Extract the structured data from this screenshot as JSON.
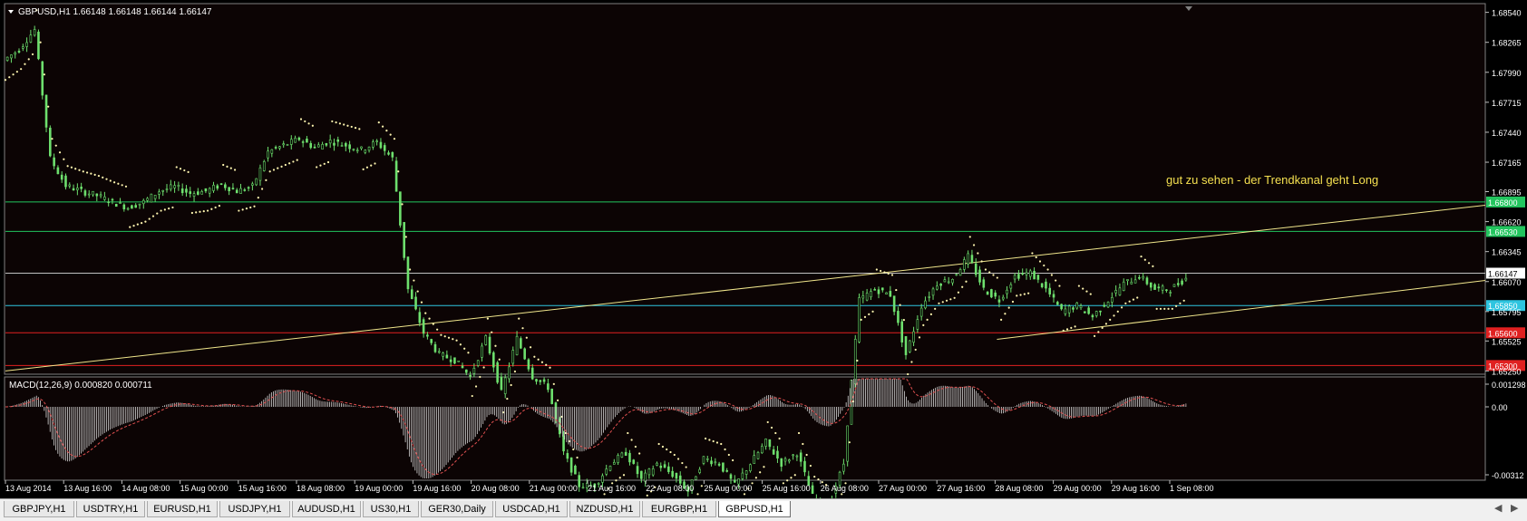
{
  "symbol_header": "GBPUSD,H1  1.66148 1.66148 1.66144 1.66147",
  "annotation": "gut zu sehen - der Trendkanal geht Long",
  "macd_header": "MACD(12,26,9) 0.000820 0.000711",
  "tabs": [
    {
      "label": "GBPJPY,H1",
      "active": false
    },
    {
      "label": "USDTRY,H1",
      "active": false
    },
    {
      "label": "EURUSD,H1",
      "active": false
    },
    {
      "label": "USDJPY,H1",
      "active": false
    },
    {
      "label": "AUDUSD,H1",
      "active": false
    },
    {
      "label": "US30,H1",
      "active": false
    },
    {
      "label": "GER30,Daily",
      "active": false
    },
    {
      "label": "USDCAD,H1",
      "active": false
    },
    {
      "label": "NZDUSD,H1",
      "active": false
    },
    {
      "label": "EURGBP,H1",
      "active": false
    },
    {
      "label": "GBPUSD,H1",
      "active": true
    }
  ],
  "chart_data": {
    "type": "candlestick",
    "symbol": "GBPUSD",
    "timeframe": "H1",
    "price_axis_ticks": [
      "1.68540",
      "1.68265",
      "1.67990",
      "1.67715",
      "1.67440",
      "1.67165",
      "1.66895",
      "1.66620",
      "1.66345",
      "1.66070",
      "1.65795",
      "1.65525",
      "1.65250"
    ],
    "ylim": [
      1.6522,
      1.6862
    ],
    "current_price": "1.66147",
    "time_axis_labels": [
      "13 Aug 2014",
      "13 Aug 16:00",
      "14 Aug 08:00",
      "15 Aug 00:00",
      "15 Aug 16:00",
      "18 Aug 08:00",
      "19 Aug 00:00",
      "19 Aug 16:00",
      "20 Aug 08:00",
      "21 Aug 00:00",
      "21 Aug 16:00",
      "22 Aug 08:00",
      "25 Aug 00:00",
      "25 Aug 16:00",
      "26 Aug 08:00",
      "27 Aug 00:00",
      "27 Aug 16:00",
      "28 Aug 08:00",
      "29 Aug 00:00",
      "29 Aug 16:00",
      "1 Sep 08:00"
    ],
    "horizontal_levels": [
      {
        "price": 1.668,
        "label": "1.66800",
        "color": "#22c55e"
      },
      {
        "price": 1.6653,
        "label": "1.66530",
        "color": "#22c55e"
      },
      {
        "price": 1.66147,
        "label": "1.66147",
        "color": "#c0c0c0"
      },
      {
        "price": 1.6585,
        "label": "1.65850",
        "color": "#2ec5e0"
      },
      {
        "price": 1.656,
        "label": "1.65600",
        "color": "#e02020"
      },
      {
        "price": 1.653,
        "label": "1.65300",
        "color": "#e02020"
      }
    ],
    "trend_lines": [
      {
        "from": [
          0,
          1.6525
        ],
        "to": [
          1.0,
          1.6677
        ],
        "color": "#f0e68c"
      },
      {
        "from": [
          0.67,
          1.6554
        ],
        "to": [
          1.0,
          1.6608
        ],
        "color": "#f0e68c"
      }
    ],
    "close_path": [
      1.681,
      1.682,
      1.6838,
      1.672,
      1.6695,
      1.669,
      1.6686,
      1.668,
      1.6675,
      1.668,
      1.669,
      1.6694,
      1.6688,
      1.669,
      1.6696,
      1.669,
      1.6694,
      1.6726,
      1.6732,
      1.6738,
      1.673,
      1.6736,
      1.6732,
      1.6728,
      1.6735,
      1.672,
      1.66,
      1.656,
      1.654,
      1.6535,
      1.652,
      1.6555,
      1.6505,
      1.6555,
      1.652,
      1.651,
      1.645,
      1.642,
      1.642,
      1.644,
      1.645,
      1.6425,
      1.644,
      1.643,
      1.6415,
      1.6445,
      1.644,
      1.642,
      1.644,
      1.646,
      1.644,
      1.645,
      1.641,
      1.64,
      1.644,
      1.659,
      1.66,
      1.6595,
      1.654,
      1.6585,
      1.6605,
      1.661,
      1.663,
      1.66,
      1.659,
      1.6612,
      1.6615,
      1.66,
      1.658,
      1.6585,
      1.6575,
      1.659,
      1.6605,
      1.6612,
      1.66,
      1.66,
      1.661
    ],
    "macd": {
      "label": "MACD(12,26,9)",
      "main": 0.00082,
      "signal": 0.000711,
      "axis_ticks": [
        "0.001298",
        "0.00",
        "-0.00312"
      ]
    }
  }
}
